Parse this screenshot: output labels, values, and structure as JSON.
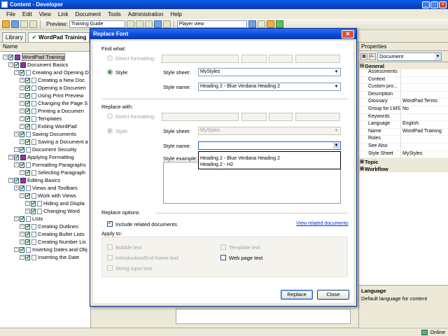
{
  "window": {
    "title": "Content - Developer"
  },
  "menu": [
    "File",
    "Edit",
    "View",
    "Link",
    "Document",
    "Tools",
    "Administration",
    "Help"
  ],
  "toolbar": {
    "preview_label": "Preview:",
    "preview_value": "Training Guide",
    "player_value": "Player view"
  },
  "tabs": {
    "library": "Library",
    "doc": "WordPad Training"
  },
  "tree": {
    "column_header": "Name",
    "items": [
      "WordPad Training",
      "Document Basics",
      "Creating and Opening D",
      "Creating a New Doc",
      "Opening a Documen",
      "Using Print Preview",
      "Changing the Page S",
      "Printing a Documen",
      "Templates",
      "Exiting WordPad",
      "Saving Documents",
      "Saving a Document a",
      "Document Security",
      "Applying Formatting",
      "Formatting Paragraphs",
      "Selecting Paragraph",
      "Editing Basics",
      "Views and Toolbars",
      "Work with Views",
      "Hiding and Displa",
      "Changing Word",
      "Lists",
      "Creating Outlines",
      "Creating Bullet Lists",
      "Creating Number Lis",
      "Inserting Dates and Obj",
      "Inserting the Date"
    ]
  },
  "properties": {
    "header": "Properties",
    "combo_value": "Document",
    "general_label": "General",
    "rows": [
      {
        "key": "Assessments",
        "value": ""
      },
      {
        "key": "Context",
        "value": ""
      },
      {
        "key": "Custom pro...",
        "value": ""
      },
      {
        "key": "Description",
        "value": ""
      },
      {
        "key": "Glossary",
        "value": "WordPad Terms"
      },
      {
        "key": "Group for LMS",
        "value": "No"
      },
      {
        "key": "Keywords",
        "value": ""
      },
      {
        "key": "Language",
        "value": "English"
      },
      {
        "key": "Name",
        "value": "WordPad Training"
      },
      {
        "key": "Roles",
        "value": ""
      },
      {
        "key": "See Also",
        "value": ""
      },
      {
        "key": "Style Sheet",
        "value": "MyStyles"
      }
    ],
    "topic_label": "Topic",
    "workflow_label": "Workflow",
    "desc_title": "Language",
    "desc_text": "Default language for content"
  },
  "status": {
    "online": "Online"
  },
  "dialog": {
    "title": "Replace Font",
    "find_what": "Find what:",
    "direct_formatting": "Direct formatting:",
    "style": "Style:",
    "style_sheet": "Style sheet:",
    "style_name": "Style name:",
    "find_style_sheet_value": "MyStyles",
    "find_style_name_value": "Heading 2 - Blue Verdana Heading 2",
    "replace_with": "Replace with:",
    "replace_style_sheet_value": "MyStyles",
    "replace_style_name_value": "",
    "style_example": "Style example:",
    "dropdown_options": [
      "Heading 2 - Blue Verdana Heading 2",
      "Heading 2 - H2"
    ],
    "replace_options": "Replace options",
    "include_related": "Include related documents",
    "view_related": "View related documents",
    "apply_to": "Apply to:",
    "apply_items_left": [
      "Bubble text",
      "Introduction/End frame text",
      "String input text"
    ],
    "apply_items_right": [
      "Template text",
      "Web page text"
    ],
    "replace_button": "Replace",
    "close_button": "Close"
  }
}
